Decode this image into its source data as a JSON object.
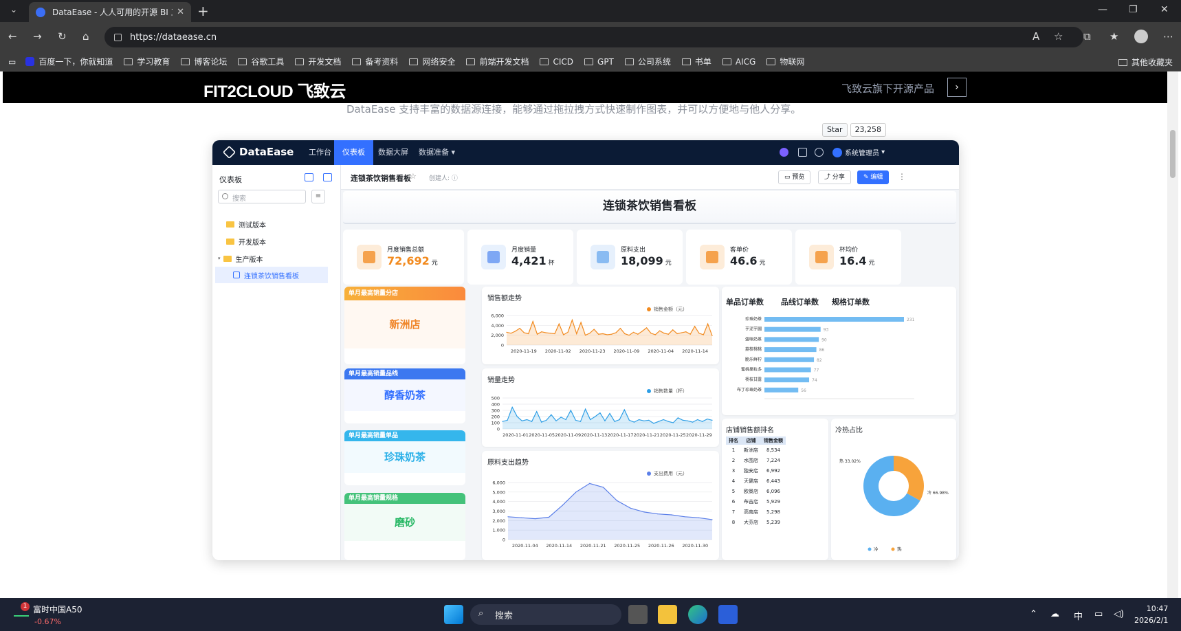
{
  "browser": {
    "tab_title": "DataEase - 人人可用的开源 BI 工具",
    "url": "https://dataease.cn",
    "bookmarks": [
      "百度一下，你就知道",
      "学习教育",
      "博客论坛",
      "谷歌工具",
      "开发文档",
      "备考资料",
      "网络安全",
      "前端开发文档",
      "CICD",
      "GPT",
      "公司系统",
      "书单",
      "AICG",
      "物联网"
    ],
    "other_bookmarks": "其他收藏夹"
  },
  "site": {
    "logo": "FIT2CLOUD 飞致云",
    "products_link": "飞致云旗下开源产品",
    "subtitle": "DataEase 支持丰富的数据源连接，能够通过拖拉拽方式快速制作图表，并可以方便地与他人分享。",
    "github_star": "Star",
    "github_count": "23,258"
  },
  "app": {
    "logo": "DataEase",
    "menu": [
      "工作台",
      "仪表板",
      "数据大屏",
      "数据准备"
    ],
    "user": "系统管理员",
    "sidebar": {
      "title": "仪表板",
      "search_placeholder": "搜索",
      "items": [
        "测试版本",
        "开发版本",
        "生产版本",
        "连锁茶饮销售看板"
      ]
    },
    "toolbar": {
      "dashboard_name": "连锁茶饮销售看板",
      "creator": "创建人:",
      "preview": "预览",
      "share": "分享",
      "edit": "编辑"
    },
    "board_title": "连锁茶饮销售看板",
    "kpis": [
      {
        "label": "月度销售总额",
        "value": "72,692",
        "unit": "元",
        "color": "#f28a1e",
        "icon": "money-icon"
      },
      {
        "label": "月度销量",
        "value": "4,421",
        "unit": "杯",
        "color": "#1f2329",
        "icon": "trend-icon"
      },
      {
        "label": "原料支出",
        "value": "18,099",
        "unit": "元",
        "color": "#1f2329",
        "icon": "box-icon"
      },
      {
        "label": "客单价",
        "value": "46.6",
        "unit": "元",
        "color": "#1f2329",
        "icon": "user-icon"
      },
      {
        "label": "杯均价",
        "value": "16.4",
        "unit": "元",
        "color": "#1f2329",
        "icon": "cup-icon"
      }
    ],
    "best": [
      {
        "header": "单月最高销量分店",
        "value": "新洲店",
        "color": "#f0862a"
      },
      {
        "header": "单月最高销量品线",
        "value": "醇香奶茶",
        "color": "#3370ff"
      },
      {
        "header": "单月最高销量单品",
        "value": "珍珠奶茶",
        "color": "#2bb0e8"
      },
      {
        "header": "单月最高销量规格",
        "value": "磨砂",
        "color": "#28b865"
      }
    ],
    "order_tabs": [
      "单品订单数",
      "品线订单数",
      "规格订单数"
    ],
    "rank_title": "店铺销售额排名",
    "rank_headers": [
      "排名",
      "店铺",
      "销售金额"
    ],
    "rank_rows": [
      [
        "1",
        "新洲店",
        "8,534"
      ],
      [
        "2",
        "水围店",
        "7,224"
      ],
      [
        "3",
        "独安店",
        "6,992"
      ],
      [
        "4",
        "天健店",
        "6,443"
      ],
      [
        "5",
        "欧景店",
        "6,096"
      ],
      [
        "6",
        "布吉店",
        "5,929"
      ],
      [
        "7",
        "高南店",
        "5,298"
      ],
      [
        "8",
        "大芬店",
        "5,239"
      ]
    ],
    "pie_title": "冷热占比"
  },
  "chart_data": [
    {
      "type": "area",
      "title": "销售额走势",
      "series": [
        {
          "name": "销售金额（元）"
        }
      ],
      "x_ticks": [
        "2020-11-19",
        "2020-11-02",
        "2020-11-23",
        "2020-11-09",
        "2020-11-04",
        "2020-11-14"
      ],
      "y_ticks": [
        "6,000",
        "4,000",
        "2,000",
        "0"
      ],
      "ylim": [
        0,
        6000
      ],
      "values": [
        2600,
        2400,
        2800,
        3400,
        2500,
        2300,
        4800,
        2200,
        2700,
        2500,
        2400,
        2300,
        4300,
        2100,
        2600,
        5100,
        2300,
        4600,
        2000,
        2400,
        3200,
        2200,
        2300,
        2100,
        2200,
        2500,
        3400,
        2300,
        2000,
        2600,
        2200,
        2800,
        3500,
        2400,
        2100,
        2900,
        2400,
        2200,
        3100,
        2300,
        2500,
        2700,
        2200,
        3800,
        2400,
        2100,
        4300,
        1900
      ],
      "color": "#f28a1e"
    },
    {
      "type": "area",
      "title": "销量走势",
      "series": [
        {
          "name": "销售数量（杯）"
        }
      ],
      "x_ticks": [
        "2020-11-01",
        "2020-11-05",
        "2020-11-09",
        "2020-11-13",
        "2020-11-17",
        "2020-11-21",
        "2020-11-25",
        "2020-11-29"
      ],
      "y_ticks": [
        "500",
        "400",
        "300",
        "200",
        "100",
        "0"
      ],
      "ylim": [
        0,
        500
      ],
      "values": [
        120,
        140,
        350,
        200,
        130,
        150,
        120,
        280,
        110,
        140,
        230,
        130,
        190,
        150,
        300,
        140,
        120,
        320,
        150,
        200,
        260,
        130,
        250,
        120,
        150,
        310,
        140,
        110,
        150,
        130,
        140,
        90,
        120,
        150,
        120,
        100,
        180,
        140,
        130,
        110,
        150,
        120,
        160,
        140
      ],
      "color": "#2d9ee6"
    },
    {
      "type": "area",
      "title": "原料支出趋势",
      "series": [
        {
          "name": "支出费用（元）"
        }
      ],
      "x_ticks": [
        "2020-11-04",
        "2020-11-14",
        "2020-11-21",
        "2020-11-25",
        "2020-11-26",
        "2020-11-30"
      ],
      "y_ticks": [
        "6,000",
        "5,000",
        "4,000",
        "3,000",
        "2,000",
        "1,000",
        "0"
      ],
      "ylim": [
        0,
        6000
      ],
      "values": [
        2400,
        2300,
        2200,
        2350,
        3600,
        5000,
        5900,
        5500,
        4100,
        3300,
        2900,
        2700,
        2600,
        2400,
        2300,
        2100
      ],
      "color": "#5b7fe8"
    },
    {
      "type": "bar",
      "title": "单品订单数",
      "categories": [
        "珍珠奶茶",
        "芋泥芋圆",
        "蛋味奶茶",
        "荔枝桃桃",
        "脆乐鲜柠",
        "蜜桃果粒多",
        "杨枝甘露",
        "布丁珍珠奶茶"
      ],
      "values": [
        231,
        93,
        90,
        86,
        82,
        77,
        74,
        56
      ],
      "color": "#5ab0f0"
    },
    {
      "type": "pie",
      "title": "冷热占比",
      "categories": [
        "冷",
        "热"
      ],
      "values": [
        66.98,
        33.02
      ],
      "labels": [
        "冷 66.98%",
        "热 33.02%"
      ],
      "colors": [
        "#5ab0f0",
        "#f7a33b"
      ]
    }
  ],
  "taskbar": {
    "stock_name": "富时中国A50",
    "stock_change": "-0.67%",
    "badge": "1",
    "search": "搜索",
    "ime": "中",
    "time": "10:47",
    "date": "2026/2/1"
  }
}
